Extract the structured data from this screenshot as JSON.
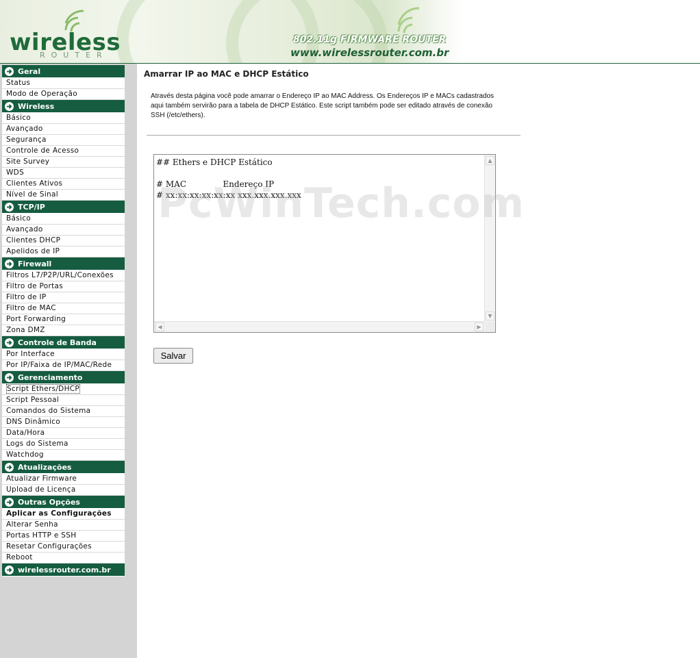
{
  "header": {
    "logo_main": "wireless",
    "logo_sub": "ROUTER",
    "tagline": "802.11g FIRMWARE ROUTER",
    "url": "www.wirelessrouter.com.br"
  },
  "sidebar": {
    "sections": [
      {
        "title": "Geral",
        "items": [
          "Status",
          "Modo de Operação"
        ]
      },
      {
        "title": "Wireless",
        "items": [
          "Básico",
          "Avançado",
          "Segurança",
          "Controle de Acesso",
          "Site Survey",
          "WDS",
          "Clientes Ativos",
          "Nível de Sinal"
        ]
      },
      {
        "title": "TCP/IP",
        "items": [
          "Básico",
          "Avançado",
          "Clientes DHCP",
          "Apelidos de IP"
        ]
      },
      {
        "title": "Firewall",
        "items": [
          "Filtros L7/P2P/URL/Conexões",
          "Filtro de Portas",
          "Filtro de IP",
          "Filtro de MAC",
          "Port Forwarding",
          "Zona DMZ"
        ]
      },
      {
        "title": "Controle de Banda",
        "items": [
          "Por Interface",
          "Por IP/Faixa de IP/MAC/Rede"
        ]
      },
      {
        "title": "Gerenciamento",
        "items": [
          "Script Ethers/DHCP",
          "Script Pessoal",
          "Comandos do Sistema",
          "DNS Dinâmico",
          "Data/Hora",
          "Logs do Sistema",
          "Watchdog"
        ]
      },
      {
        "title": "Atualizações",
        "items": [
          "Atualizar Firmware",
          "Upload de Licença"
        ]
      },
      {
        "title": "Outras Opções",
        "items": [
          "Aplicar as Configurações",
          "Alterar Senha",
          "Portas HTTP e SSH",
          "Resetar Configurações",
          "Reboot"
        ]
      },
      {
        "title": "wirelessrouter.com.br",
        "items": []
      }
    ],
    "active_item": "Script Ethers/DHCP",
    "bold_item": "Aplicar as Configurações"
  },
  "main": {
    "title": "Amarrar IP ao MAC e DHCP Estático",
    "description": "Através desta página você pode amarrar o Endereço IP ao MAC Address. Os Endereços IP e MACs cadastrados aqui também servirão para a tabela de DHCP Estático. Este script também pode ser editado através de conexão SSH (/etc/ethers).",
    "editor_content": "## Ethers e DHCP Estático\n\n# MAC              Endereço IP\n# xx:xx:xx:xx:xx:xx xxx.xxx.xxx.xxx",
    "save_label": "Salvar",
    "watermark": "PcWinTech.com"
  },
  "colors": {
    "accent": "#155c40",
    "sidebar_bg": "#d4d4d4"
  }
}
